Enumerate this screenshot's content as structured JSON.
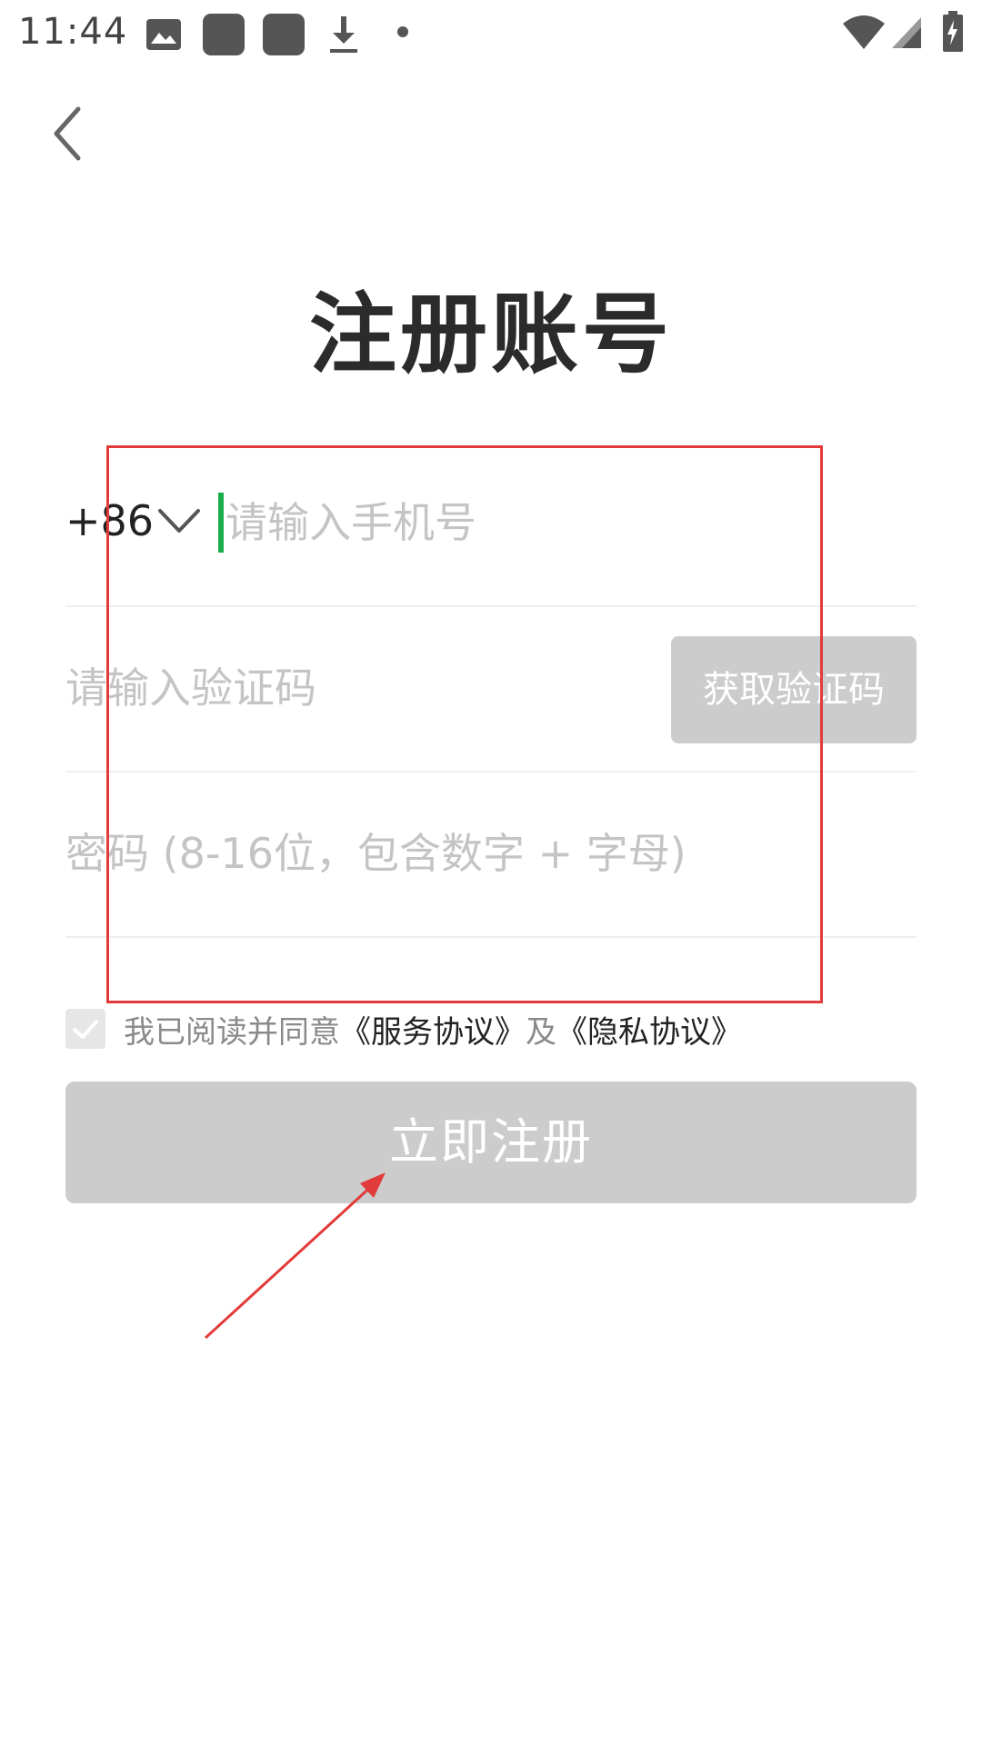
{
  "status_bar": {
    "time": "11:44",
    "left_icons": [
      "image-icon",
      "app-square-icon",
      "app-square-icon",
      "download-icon",
      "dot-icon"
    ],
    "right_icons": [
      "wifi-icon",
      "signal-icon",
      "battery-charging-icon"
    ]
  },
  "header": {
    "back_icon": "chevron-left-icon",
    "title": "注册账号"
  },
  "form": {
    "country_code": "+86",
    "phone_placeholder": "请输入手机号",
    "code_placeholder": "请输入验证码",
    "get_code_label": "获取验证码",
    "password_placeholder": "密码 (8-16位，包含数字 + 字母)"
  },
  "agreement": {
    "prefix": "我已阅读并同意",
    "service_link": "《服务协议》",
    "conjunction": "及",
    "privacy_link": "《隐私协议》",
    "checked": true
  },
  "register_label": "立即注册",
  "colors": {
    "cursor": "#1aad4b",
    "disabled_button": "#cccccc",
    "annotation": "#e23b3b",
    "title": "#2b2b2b",
    "placeholder": "#c4c4c4"
  }
}
